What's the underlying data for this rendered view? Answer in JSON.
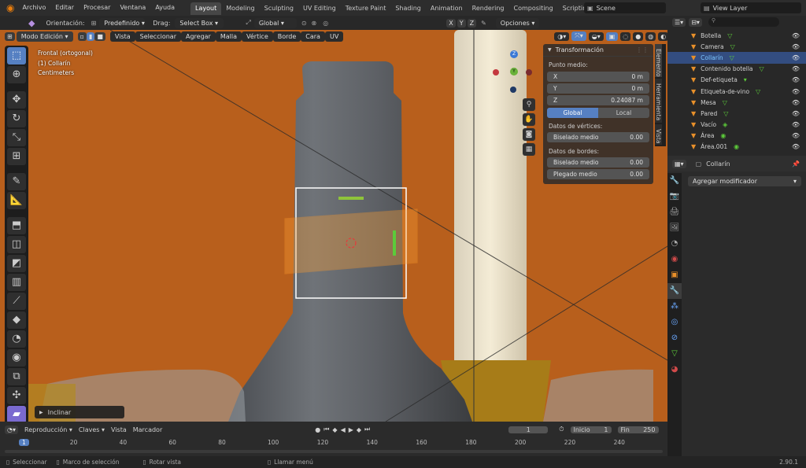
{
  "topbar": {
    "menus": [
      "Archivo",
      "Editar",
      "Procesar",
      "Ventana",
      "Ayuda"
    ],
    "workspaces": [
      "Layout",
      "Modeling",
      "Sculpting",
      "UV Editing",
      "Texture Paint",
      "Shading",
      "Animation",
      "Rendering",
      "Compositing",
      "Scripting"
    ],
    "active_workspace": "Layout",
    "scene": "Scene",
    "view_layer": "View Layer",
    "add": "+"
  },
  "header": {
    "orientation_label": "Orientación:",
    "orientation_value": "Predefinido",
    "drag_label": "Drag:",
    "drag_value": "Select Box",
    "transform_orientation": "Global",
    "options": "Opciones",
    "mode": "Modo Edición",
    "menus": [
      "Vista",
      "Seleccionar",
      "Agregar",
      "Malla",
      "Vértice",
      "Borde",
      "Cara",
      "UV"
    ],
    "axes": [
      "X",
      "Y",
      "Z"
    ]
  },
  "viewport": {
    "view_name": "Frontal (ortogonal)",
    "object_name": "(1) Collarín",
    "units": "Centimeters",
    "last_op": "Inclinar",
    "gizmo": {
      "z": "Z",
      "y": "Y"
    }
  },
  "npanel": {
    "title": "Transformación",
    "median_label": "Punto medio:",
    "fields": [
      {
        "label": "X",
        "value": "0 m"
      },
      {
        "label": "Y",
        "value": "0 m"
      },
      {
        "label": "Z",
        "value": "0.24087 m"
      }
    ],
    "global": "Global",
    "local": "Local",
    "vertex_data": "Datos de vértices:",
    "vertex_bevel": {
      "label": "Biselado medio",
      "value": "0.00"
    },
    "edge_data": "Datos de bordes:",
    "edge_bevel": {
      "label": "Biselado medio",
      "value": "0.00"
    },
    "edge_crease": {
      "label": "Plegado medio",
      "value": "0.00"
    },
    "tabs": [
      "Elemento",
      "Herramienta",
      "Vista"
    ]
  },
  "outliner": {
    "items": [
      {
        "name": "Botella",
        "selected": false
      },
      {
        "name": "Camera",
        "selected": false
      },
      {
        "name": "Collarín",
        "selected": true
      },
      {
        "name": "Contenido botella",
        "selected": false
      },
      {
        "name": "Def-etiqueta",
        "selected": false
      },
      {
        "name": "Etiqueta-de-vino",
        "selected": false
      },
      {
        "name": "Mesa",
        "selected": false
      },
      {
        "name": "Pared",
        "selected": false
      },
      {
        "name": "Vacío",
        "selected": false
      },
      {
        "name": "Área",
        "selected": false
      },
      {
        "name": "Área.001",
        "selected": false
      }
    ]
  },
  "properties": {
    "object": "Collarín",
    "add_modifier": "Agregar modificador"
  },
  "timeline": {
    "menus": [
      "Reproducción",
      "Claves",
      "Vista",
      "Marcador"
    ],
    "current_frame": "1",
    "start_label": "Inicio",
    "start": "1",
    "end_label": "Fin",
    "end": "250",
    "ruler": [
      "1",
      "20",
      "40",
      "60",
      "80",
      "100",
      "120",
      "140",
      "160",
      "180",
      "200",
      "220",
      "240"
    ]
  },
  "status": {
    "select": "Seleccionar",
    "box": "Marco de selección",
    "rotate": "Rotar vista",
    "menu": "Llamar menú",
    "version": "2.90.1"
  },
  "colors": {
    "accent": "#5680c2",
    "selection": "#334d80",
    "background_wall": "#c2651e",
    "mesh_select": "#ffa033"
  }
}
